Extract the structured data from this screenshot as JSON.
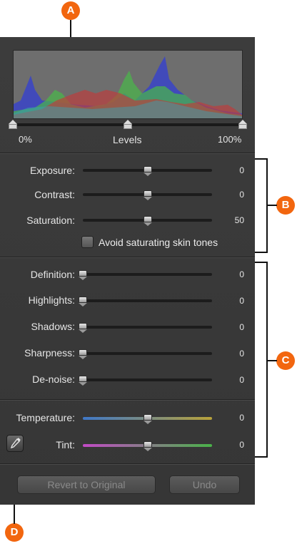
{
  "levels": {
    "left_label": "0%",
    "center_label": "Levels",
    "right_label": "100%",
    "black_point": 0,
    "mid_point": 0.5,
    "white_point": 1
  },
  "adjustments": {
    "exposure": {
      "label": "Exposure:",
      "value": "0",
      "position": 0.5
    },
    "contrast": {
      "label": "Contrast:",
      "value": "0",
      "position": 0.5
    },
    "saturation": {
      "label": "Saturation:",
      "value": "50",
      "position": 0.5
    },
    "skin_tones": {
      "label": "Avoid saturating skin tones",
      "checked": false
    }
  },
  "details": {
    "definition": {
      "label": "Definition:",
      "value": "0",
      "position": 0
    },
    "highlights": {
      "label": "Highlights:",
      "value": "0",
      "position": 0
    },
    "shadows": {
      "label": "Shadows:",
      "value": "0",
      "position": 0
    },
    "sharpness": {
      "label": "Sharpness:",
      "value": "0",
      "position": 0
    },
    "denoise": {
      "label": "De-noise:",
      "value": "0",
      "position": 0
    }
  },
  "color": {
    "temperature": {
      "label": "Temperature:",
      "value": "0",
      "position": 0.5
    },
    "tint": {
      "label": "Tint:",
      "value": "0",
      "position": 0.5
    },
    "eyedropper_icon": "eyedropper-icon"
  },
  "buttons": {
    "revert": "Revert to Original",
    "undo": "Undo"
  },
  "callouts": {
    "a": "A",
    "b": "B",
    "c": "C",
    "d": "D"
  },
  "colors": {
    "callout": "#f2660f",
    "panel": "#3a3a3a"
  }
}
